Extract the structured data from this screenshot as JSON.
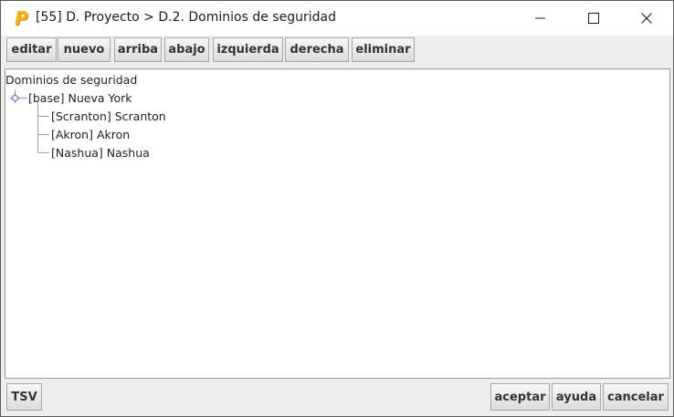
{
  "window": {
    "title": "[55] D. Proyecto > D.2. Dominios de seguridad",
    "app_icon_letter": "P",
    "app_icon_color": "#f3b51b"
  },
  "toolbar": {
    "editar": "editar",
    "nuevo": "nuevo",
    "arriba": "arriba",
    "abajo": "abajo",
    "izquierda": "izquierda",
    "derecha": "derecha",
    "eliminar": "eliminar"
  },
  "tree": {
    "root_label": "Dominios de seguridad",
    "node": {
      "label": "[base] Nueva York",
      "expanded": true,
      "children": [
        {
          "label": "[Scranton] Scranton"
        },
        {
          "label": "[Akron] Akron"
        },
        {
          "label": "[Nashua] Nashua"
        }
      ]
    }
  },
  "footer": {
    "tsv": "TSV",
    "aceptar": "aceptar",
    "ayuda": "ayuda",
    "cancelar": "cancelar"
  },
  "icons": {
    "minimize": "minimize-icon",
    "maximize": "maximize-icon",
    "close": "close-icon",
    "tree_toggle": "tree-expand-toggle-icon"
  }
}
